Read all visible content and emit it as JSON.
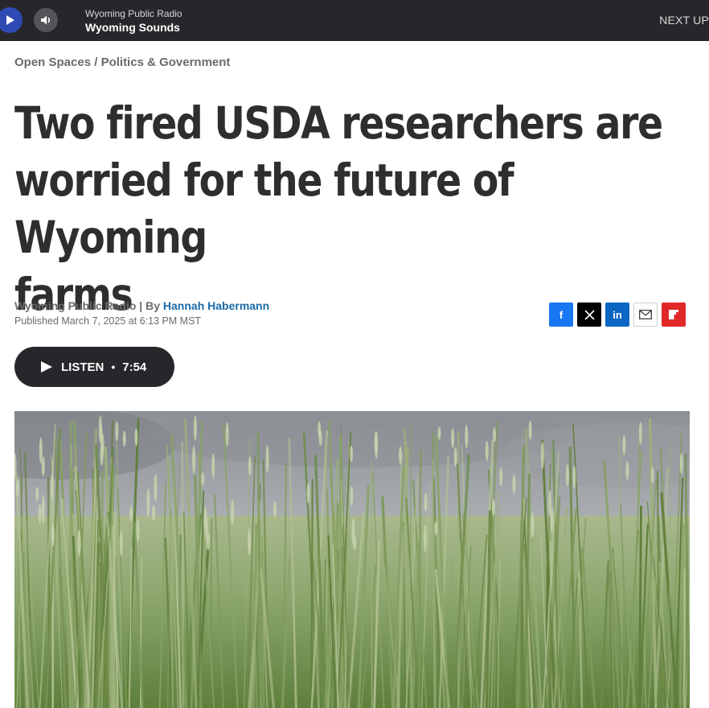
{
  "player": {
    "station": "Wyoming Public Radio",
    "program": "Wyoming Sounds",
    "next_up": "NEXT UP"
  },
  "breadcrumb": {
    "first": "Open Spaces",
    "separator": " / ",
    "second": "Politics & Government"
  },
  "article": {
    "headline_line1": "Two fired USDA researchers are",
    "headline_line2": "worried for the future of Wyoming",
    "headline_line3": "farms",
    "source": "Wyoming Public Radio",
    "by": " | By ",
    "author": "Hannah Habermann",
    "published": "Published March 7, 2025 at 6:13 PM MST"
  },
  "listen": {
    "label": "LISTEN",
    "separator": "•",
    "duration": "7:54"
  },
  "share": {
    "facebook": "f",
    "linkedin": "in"
  },
  "colors": {
    "player_bg": "#27272b",
    "play_button": "#2f4ab3",
    "author_link": "#1a6aa8",
    "facebook": "#1877f2",
    "linkedin": "#0a66c2",
    "flipboard": "#e12828"
  },
  "icons": {
    "play": "play-icon",
    "volume": "volume-icon",
    "x": "x-logo-icon",
    "mail": "mail-icon",
    "flipboard": "flipboard-icon"
  }
}
